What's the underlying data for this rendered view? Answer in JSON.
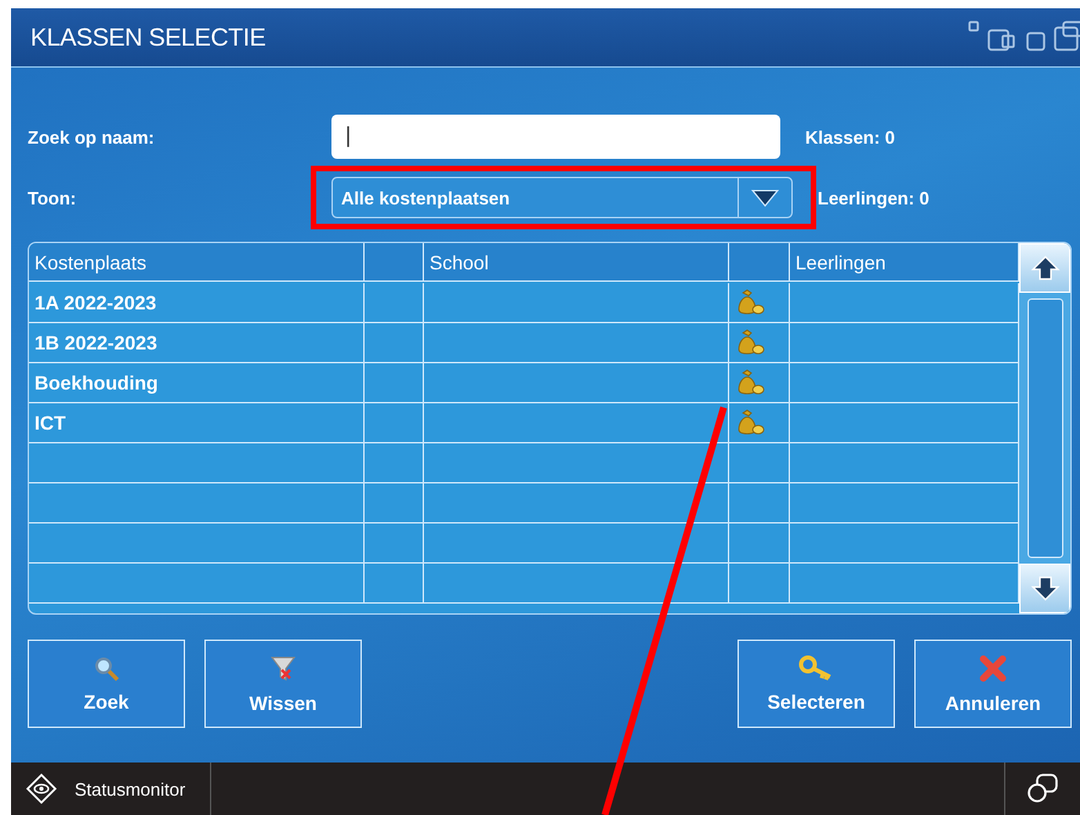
{
  "window": {
    "title": "KLASSEN SELECTIE"
  },
  "search": {
    "label": "Zoek op naam:",
    "value": "|"
  },
  "filter": {
    "label": "Toon:",
    "value": "Alle kostenplaatsen",
    "highlighted": true
  },
  "counts": [
    "Klassen: 0",
    "Leerlingen: 0"
  ],
  "table": {
    "columns": [
      "Kostenplaats",
      "",
      "School",
      "",
      "Leerlingen"
    ],
    "rows": [
      {
        "cells": [
          "1A 2022-2023",
          "",
          "",
          "",
          ""
        ],
        "has_money_icon": true
      },
      {
        "cells": [
          "1B 2022-2023",
          "",
          "",
          "",
          ""
        ],
        "has_money_icon": true
      },
      {
        "cells": [
          "Boekhouding",
          "",
          "",
          "",
          ""
        ],
        "has_money_icon": true
      },
      {
        "cells": [
          "ICT",
          "",
          "",
          "",
          ""
        ],
        "has_money_icon": true
      }
    ]
  },
  "buttons_left": [
    {
      "label": "Zoek",
      "kind": "search"
    },
    {
      "label": "Wissen",
      "kind": "clear"
    }
  ],
  "buttons_right": [
    {
      "label": "Selecteren",
      "kind": "select"
    },
    {
      "label": "Annuleren",
      "kind": "cancel"
    }
  ],
  "status_bar": {
    "label": "Statusmonitor"
  }
}
